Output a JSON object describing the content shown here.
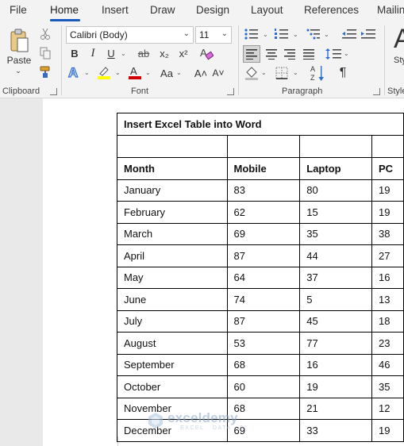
{
  "tabs": [
    {
      "label": "File"
    },
    {
      "label": "Home"
    },
    {
      "label": "Insert"
    },
    {
      "label": "Draw"
    },
    {
      "label": "Design"
    },
    {
      "label": "Layout"
    },
    {
      "label": "References"
    },
    {
      "label": "Mailin"
    }
  ],
  "ribbon": {
    "clipboard": {
      "paste_label": "Paste",
      "group_label": "Clipboard"
    },
    "font": {
      "font_name": "Calibri (Body)",
      "font_size": "11",
      "group_label": "Font",
      "bold": "B",
      "italic": "I",
      "underline": "U",
      "strike": "ab",
      "subscript": "x₂",
      "superscript": "x²",
      "case_label": "Aa",
      "grow": "A˄",
      "shrink": "A˅"
    },
    "paragraph": {
      "group_label": "Paragraph",
      "pilcrow": "¶",
      "sort_label": "A↓Z"
    },
    "styles": {
      "glyph": "A",
      "label": "Sty",
      "group_label": "Style"
    }
  },
  "colors": {
    "accent": "#185abd",
    "highlight": "#ffff00",
    "font_color": "#d40000"
  },
  "table": {
    "title": "Insert Excel Table into Word",
    "headers": [
      "Month",
      "Mobile",
      "Laptop",
      "PC"
    ],
    "rows": [
      [
        "January",
        "83",
        "80",
        "19"
      ],
      [
        "February",
        "62",
        "15",
        "19"
      ],
      [
        "March",
        "69",
        "35",
        "38"
      ],
      [
        "April",
        "87",
        "44",
        "27"
      ],
      [
        "May",
        "64",
        "37",
        "16"
      ],
      [
        "June",
        "74",
        "5",
        "13"
      ],
      [
        "July",
        "87",
        "45",
        "18"
      ],
      [
        "August",
        "53",
        "77",
        "23"
      ],
      [
        "September",
        "68",
        "16",
        "46"
      ],
      [
        "October",
        "60",
        "19",
        "35"
      ],
      [
        "November",
        "68",
        "21",
        "12"
      ],
      [
        "December",
        "69",
        "33",
        "19"
      ]
    ]
  },
  "watermark": {
    "name": "exceldemy",
    "tagline": "EXCEL · DATA · BI"
  }
}
